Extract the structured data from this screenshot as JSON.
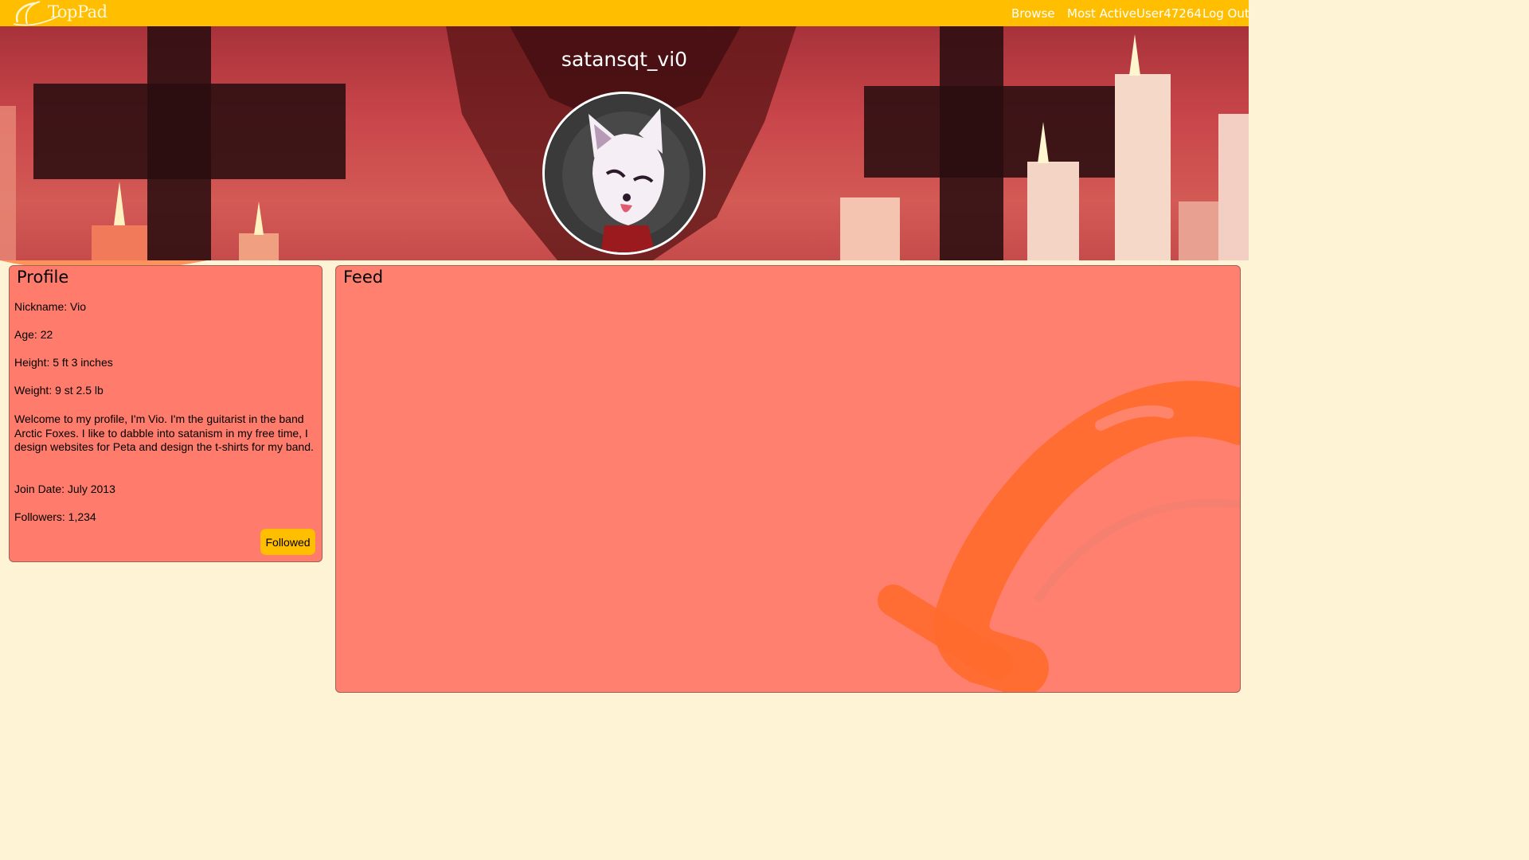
{
  "app": {
    "logo_text": "TopPad"
  },
  "nav": {
    "browse": "Browse",
    "most_active": "Most Active",
    "user": "User47264",
    "logout": "Log Out"
  },
  "profile_header": {
    "username": "satansqt_vi0"
  },
  "profile": {
    "title": "Profile",
    "nickname": "Nickname: Vio",
    "age": "Age: 22",
    "height": "Height: 5 ft 3 inches",
    "weight": "Weight: 9 st 2.5 lb",
    "bio": "Welcome to my profile, I'm Vio. I'm the guitarist in the band Arctic Foxes. I like to dabble into satanism in my free time, I design websites for Peta and design the t-shirts for my band.",
    "join_date": "Join Date: July 2013",
    "followers": "Followers: 1,234",
    "follow_button": "Followed"
  },
  "feed": {
    "title": "Feed"
  },
  "colors": {
    "topbar": "#ffbe00",
    "page_bg": "#fef3d4",
    "panel_bg": "#ff7b6b",
    "button_bg": "#ffbe00",
    "decor_orange": "#ff6a2c"
  }
}
